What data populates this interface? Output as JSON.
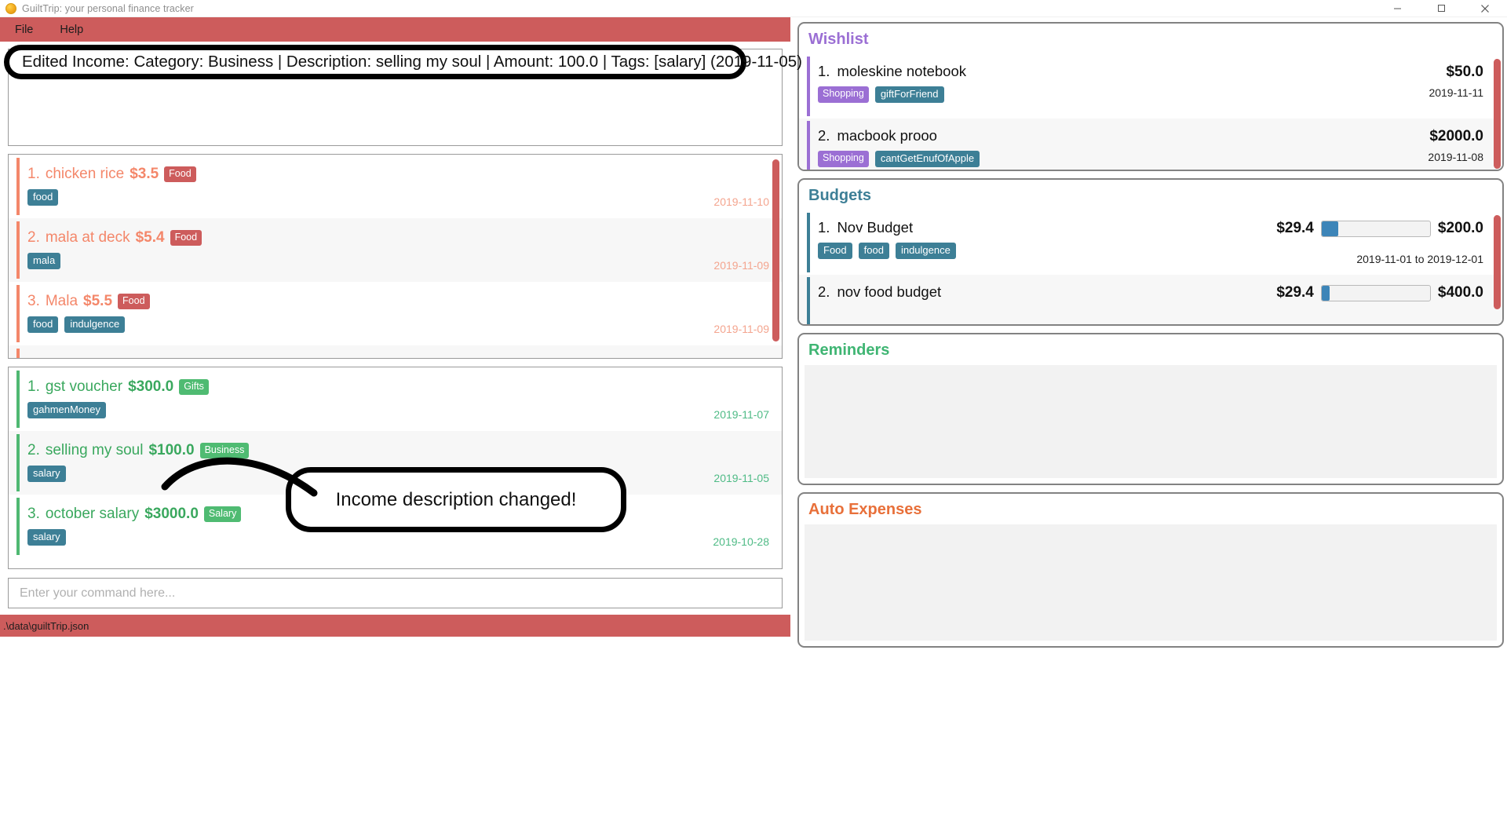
{
  "window": {
    "title": "GuiltTrip: your personal finance tracker",
    "icon": "coin-icon",
    "controls": {
      "minimize": "minimize-icon",
      "maximize": "maximize-icon",
      "close": "close-icon"
    }
  },
  "menubar": {
    "items": [
      "File",
      "Help"
    ]
  },
  "result_box": {
    "text": ""
  },
  "annotations": {
    "banner": "Edited Income: Category: Business | Description: selling my soul | Amount: 100.0 | Tags: [salary] (2019-11-05)",
    "bubble": "Income description changed!"
  },
  "expenses": {
    "accent": "#f4876a",
    "items": [
      {
        "index": "1.",
        "description": "chicken rice",
        "amount": "$3.5",
        "category": "Food",
        "tags": [
          "food"
        ],
        "date": "2019-11-10"
      },
      {
        "index": "2.",
        "description": "mala at deck",
        "amount": "$5.4",
        "category": "Food",
        "tags": [
          "mala"
        ],
        "date": "2019-11-09"
      },
      {
        "index": "3.",
        "description": "Mala",
        "amount": "$5.5",
        "category": "Food",
        "tags": [
          "food",
          "indulgence"
        ],
        "date": "2019-11-09"
      }
    ]
  },
  "incomes": {
    "accent": "#4fb872",
    "items": [
      {
        "index": "1.",
        "description": "gst voucher",
        "amount": "$300.0",
        "category": "Gifts",
        "tags": [
          "gahmenMoney"
        ],
        "date": "2019-11-07"
      },
      {
        "index": "2.",
        "description": "selling my soul",
        "amount": "$100.0",
        "category": "Business",
        "tags": [
          "salary"
        ],
        "date": "2019-11-05"
      },
      {
        "index": "3.",
        "description": "october salary",
        "amount": "$3000.0",
        "category": "Salary",
        "tags": [
          "salary"
        ],
        "date": "2019-10-28"
      }
    ]
  },
  "command_bar": {
    "value": "",
    "placeholder": "Enter your command here..."
  },
  "statusbar": {
    "path": ".\\data\\guiltTrip.json"
  },
  "wishlist": {
    "title": "Wishlist",
    "accent": "#9b6fd4",
    "items": [
      {
        "index": "1.",
        "name": "moleskine notebook",
        "category": "Shopping",
        "tags": [
          "giftForFriend"
        ],
        "price": "$50.0",
        "date": "2019-11-11"
      },
      {
        "index": "2.",
        "name": "macbook prooo",
        "category": "Shopping",
        "tags": [
          "cantGetEnufOfApple"
        ],
        "price": "$2000.0",
        "date": "2019-11-08"
      }
    ]
  },
  "budgets": {
    "title": "Budgets",
    "accent": "#3d7f96",
    "items": [
      {
        "index": "1.",
        "name": "Nov Budget",
        "tags": [
          "Food",
          "food",
          "indulgence"
        ],
        "spent": "$29.4",
        "total": "$200.0",
        "percent": 15,
        "range": "2019-11-01 to 2019-12-01"
      },
      {
        "index": "2.",
        "name": "nov food budget",
        "tags": [],
        "spent": "$29.4",
        "total": "$400.0",
        "percent": 7,
        "range": ""
      }
    ]
  },
  "reminders": {
    "title": "Reminders",
    "accent": "#3fb573",
    "items": []
  },
  "auto_expenses": {
    "title": "Auto Expenses",
    "accent": "#e8703a",
    "items": []
  }
}
